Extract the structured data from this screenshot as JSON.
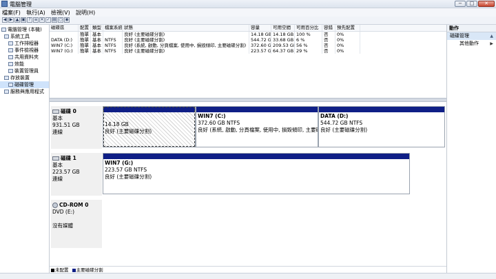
{
  "window": {
    "title": "電腦管理",
    "min": "−",
    "max": "□",
    "close": "✕"
  },
  "menu": [
    "檔案(F)",
    "執行(A)",
    "檢視(V)",
    "說明(H)"
  ],
  "toolbar_icons": [
    "back-icon",
    "forward-icon",
    "up-icon",
    "console-icon",
    "help-icon",
    "properties-icon",
    "delete-icon",
    "check-icon",
    "open-icon",
    "search-icon",
    "media-icon"
  ],
  "tree": [
    {
      "label": "電腦管理 (本機)",
      "indent": 0
    },
    {
      "label": "系統工具",
      "indent": 1
    },
    {
      "label": "工作排程器",
      "indent": 2
    },
    {
      "label": "事件檢視器",
      "indent": 2
    },
    {
      "label": "共用資料夾",
      "indent": 2
    },
    {
      "label": "效能",
      "indent": 2
    },
    {
      "label": "裝置管理員",
      "indent": 2
    },
    {
      "label": "存放裝置",
      "indent": 1
    },
    {
      "label": "磁碟管理",
      "indent": 2,
      "selected": true
    },
    {
      "label": "服務與應用程式",
      "indent": 1
    }
  ],
  "volumes": {
    "headers": [
      "磁碟區",
      "配置",
      "類型",
      "檔案系統",
      "狀態",
      "容量",
      "可用空間",
      "可用百分比",
      "容錯",
      "預先配置"
    ],
    "rows": [
      [
        "",
        "簡單",
        "基本",
        "",
        "良好 (主要磁碟分割)",
        "14.18 GB",
        "14.18 GB",
        "100 %",
        "否",
        "0%"
      ],
      [
        "DATA (D:)",
        "簡單",
        "基本",
        "NTFS",
        "良好 (主要磁碟分割)",
        "544.72 GB",
        "33.68 GB",
        "6 %",
        "否",
        "0%"
      ],
      [
        "WIN7 (C:)",
        "簡單",
        "基本",
        "NTFS",
        "良好 (系統, 啟動, 分頁檔案, 使用中, 損毀傾印, 主要磁碟分割)",
        "372.60 GB",
        "209.53 GB",
        "56 %",
        "否",
        "0%"
      ],
      [
        "WIN7 (G:)",
        "簡單",
        "基本",
        "NTFS",
        "良好 (主要磁碟分割)",
        "223.57 GB",
        "64.37 GB",
        "29 %",
        "否",
        "0%"
      ]
    ]
  },
  "disks": {
    "disk0": {
      "name": "磁碟 0",
      "type": "基本",
      "size": "931.51 GB",
      "status": "連線",
      "p1": {
        "size": "14.18 GB",
        "status": "良好 (主要磁碟分割)"
      },
      "p2": {
        "name": "WIN7 (C:)",
        "fs": "372.60 GB NTFS",
        "status": "良好 (系統, 啟動, 分頁檔案, 使用中, 損毀傾印, 主要磁碟分割)"
      },
      "p3": {
        "name": "DATA (D:)",
        "fs": "544.72 GB NTFS",
        "status": "良好 (主要磁碟分割)"
      }
    },
    "disk1": {
      "name": "磁碟 1",
      "type": "基本",
      "size": "223.57 GB",
      "status": "連線",
      "p1": {
        "name": "WIN7 (G:)",
        "fs": "223.57 GB NTFS",
        "status": "良好 (主要磁碟分割)"
      }
    },
    "cdrom0": {
      "name": "CD-ROM 0",
      "drive": "DVD (E:)",
      "status": "沒有媒體"
    }
  },
  "legend": {
    "unallocated": "未配置",
    "primary": "主要磁碟分割",
    "colors": {
      "unallocated": "#000000",
      "primary": "#0f1f86"
    }
  },
  "actions": {
    "header": "動作",
    "section": "磁碟管理",
    "more": "其他動作"
  }
}
